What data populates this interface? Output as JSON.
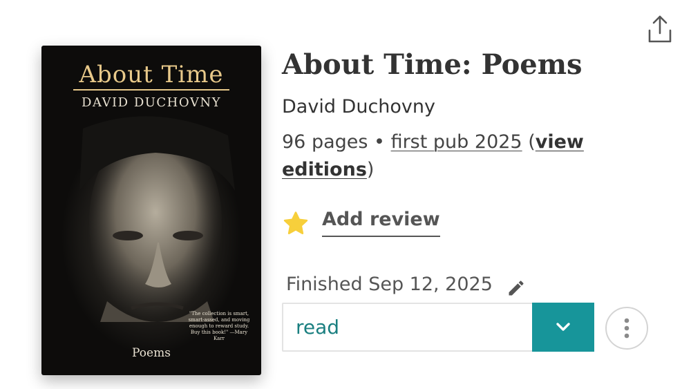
{
  "book": {
    "title": "About Time: Poems",
    "author": "David Duchovny",
    "pages": "96 pages",
    "separator": "•",
    "first_pub": "first pub 2025",
    "view_editions": "view editions",
    "paren_open": "(",
    "paren_close": ")"
  },
  "cover": {
    "title": "About Time",
    "author": "DAVID DUCHOVNY",
    "blurb": "\"The collection is smart, smart-assed, and moving enough to reward study. Buy this book!\" —Mary Karr",
    "subtitle": "Poems",
    "colors": {
      "title": "#e8c98a",
      "text": "#e9e2d2",
      "background": "#0d0c0b"
    }
  },
  "review": {
    "label": "Add review",
    "icon": "star-icon",
    "icon_color": "#f7cf3b"
  },
  "status": {
    "finished_label": "Finished Sep 12, 2025",
    "edit_icon": "pencil-icon",
    "shelf_value": "read",
    "shelf_color": "#1a7f80",
    "toggle_color": "#17959a",
    "toggle_icon": "chevron-down-icon",
    "more_icon": "more-vertical-icon"
  },
  "toolbar": {
    "share_icon": "share-icon"
  }
}
